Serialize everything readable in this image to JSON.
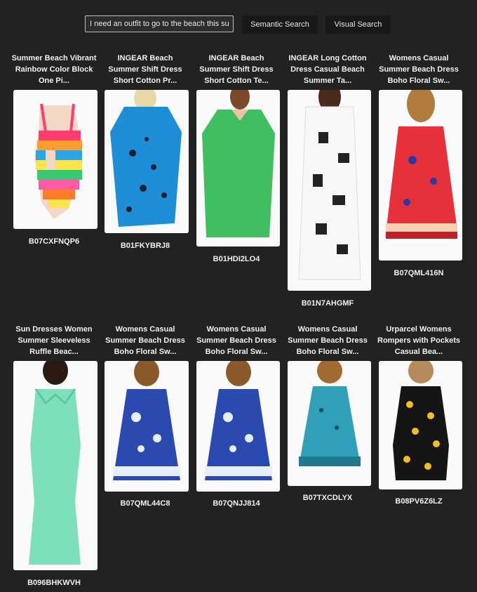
{
  "search": {
    "query": "I need an outfit to go to the beach this summer",
    "semantic_label": "Semantic Search",
    "visual_label": "Visual Search"
  },
  "results": [
    {
      "title": [
        "Summer Beach Vibrant",
        "Rainbow Color Block",
        "One Pi..."
      ],
      "code": "B07CXFNQP6"
    },
    {
      "title": [
        "INGEAR Beach",
        "Summer Shift Dress",
        "Short Cotton Pr..."
      ],
      "code": "B01FKYBRJ8"
    },
    {
      "title": [
        "INGEAR Beach",
        "Summer Shift Dress",
        "Short Cotton Te..."
      ],
      "code": "B01HDI2LO4"
    },
    {
      "title": [
        "INGEAR Long Cotton",
        "Dress Casual Beach",
        "Summer Ta..."
      ],
      "code": "B01N7AHGMF"
    },
    {
      "title": [
        "Womens Casual",
        "Summer Beach Dress",
        "Boho Floral Sw..."
      ],
      "code": "B07QML416N"
    },
    {
      "title": [
        "Sun Dresses Women",
        "Summer Sleeveless",
        "Ruffle Beac..."
      ],
      "code": "B096BHKWVH"
    },
    {
      "title": [
        "Womens Casual",
        "Summer Beach Dress",
        "Boho Floral Sw..."
      ],
      "code": "B07QML44C8"
    },
    {
      "title": [
        "Womens Casual",
        "Summer Beach Dress",
        "Boho Floral Sw..."
      ],
      "code": "B07QNJJ814"
    },
    {
      "title": [
        "Womens Casual",
        "Summer Beach Dress",
        "Boho Floral Sw..."
      ],
      "code": "B07TXCDLYX"
    },
    {
      "title": [
        "Urparcel Womens",
        "Rompers with Pockets",
        "Casual Bea..."
      ],
      "code": "B08PV6Z6LZ"
    }
  ]
}
